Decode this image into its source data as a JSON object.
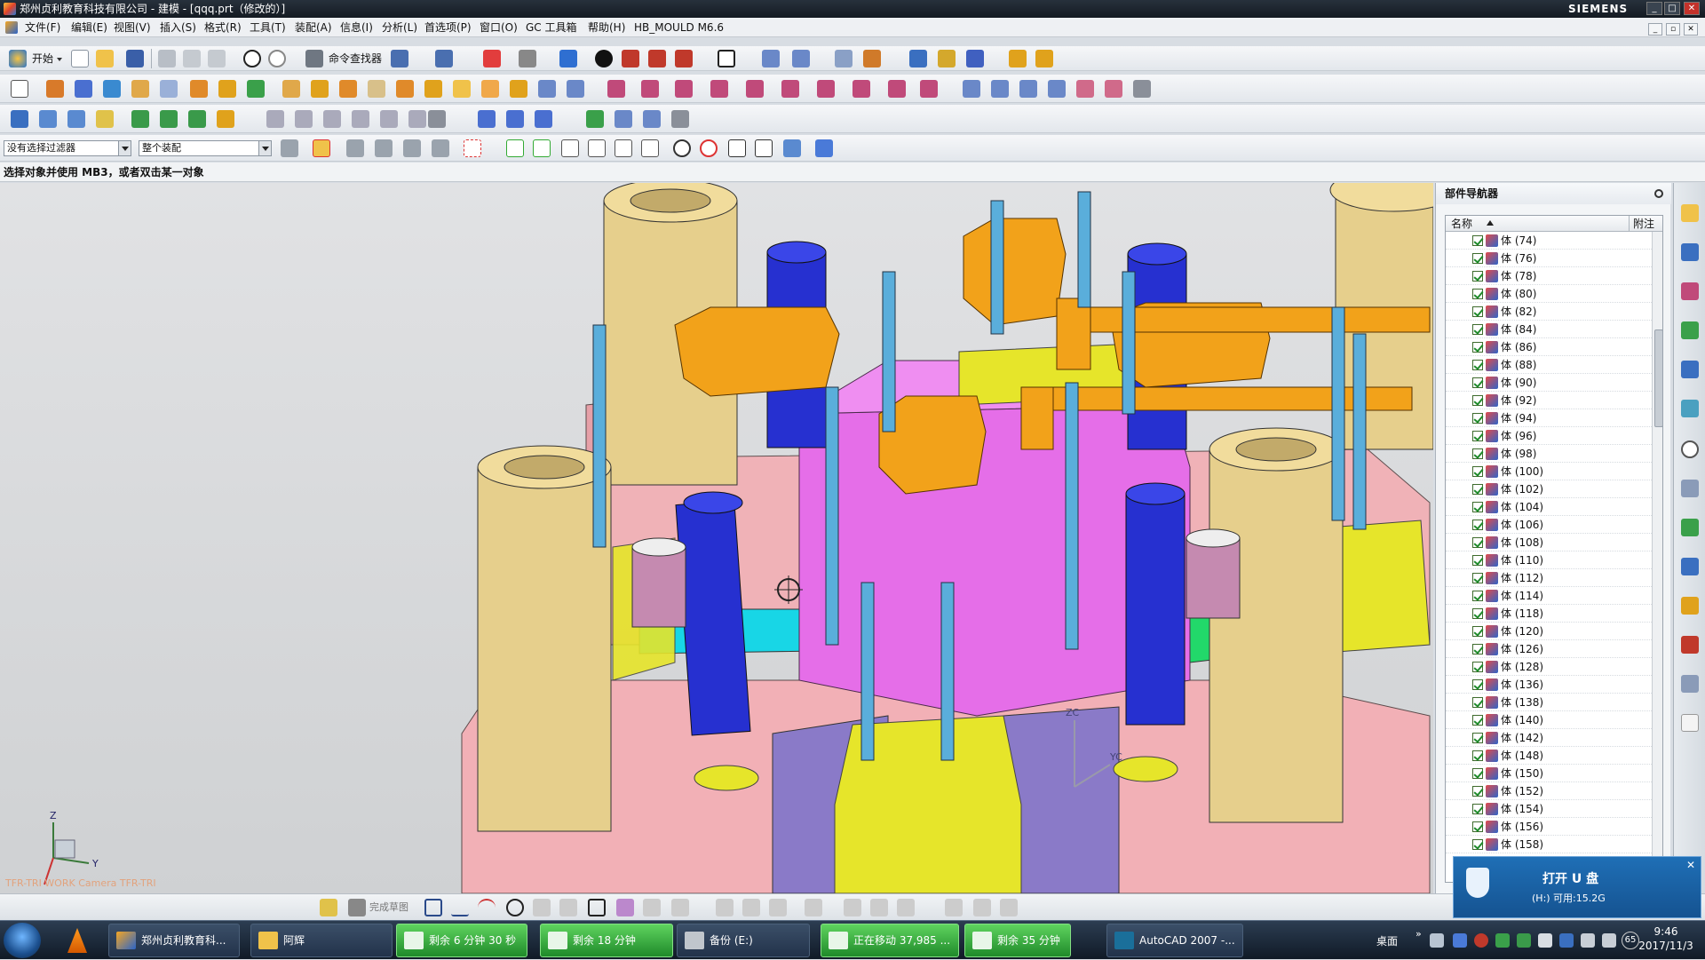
{
  "window": {
    "title": "郑州贞利教育科技有限公司 - 建模 - [qqq.prt（修改的）]",
    "brand": "SIEMENS"
  },
  "menu": [
    "文件(F)",
    "编辑(E)",
    "视图(V)",
    "插入(S)",
    "格式(R)",
    "工具(T)",
    "装配(A)",
    "信息(I)",
    "分析(L)",
    "首选项(P)",
    "窗口(O)",
    "GC 工具箱",
    "帮助(H)",
    "HB_MOULD M6.6"
  ],
  "toolbar": {
    "start_label": "开始",
    "command_finder_label": "命令查找器"
  },
  "filters": {
    "selection_filter": "没有选择过滤器",
    "scope": "整个装配"
  },
  "cue_line": "选择对象并使用 MB3，或者双击某一对象",
  "viewport": {
    "view_label": "TFR-TRI WORK Camera TFR-TRI",
    "triad_labels": {
      "z": "Z",
      "y": "Y",
      "zc": "ZC",
      "yc": "YC"
    }
  },
  "part_navigator": {
    "title": "部件导航器",
    "columns": {
      "name": "名称",
      "note": "附注"
    },
    "items": [
      "体 (74)",
      "体 (76)",
      "体 (78)",
      "体 (80)",
      "体 (82)",
      "体 (84)",
      "体 (86)",
      "体 (88)",
      "体 (90)",
      "体 (92)",
      "体 (94)",
      "体 (96)",
      "体 (98)",
      "体 (100)",
      "体 (102)",
      "体 (104)",
      "体 (106)",
      "体 (108)",
      "体 (110)",
      "体 (112)",
      "体 (114)",
      "体 (118)",
      "体 (120)",
      "体 (126)",
      "体 (128)",
      "体 (136)",
      "体 (138)",
      "体 (140)",
      "体 (142)",
      "体 (148)",
      "体 (150)",
      "体 (152)",
      "体 (154)",
      "体 (156)",
      "体 (158)"
    ]
  },
  "sketch_bar": {
    "finish_sketch": "完成草图"
  },
  "usb_notification": {
    "title": "打开 U 盘",
    "subtitle": "(H:)  可用:15.2G"
  },
  "taskbar": {
    "items": [
      {
        "label": "郑州贞利教育科...",
        "style": "normal"
      },
      {
        "label": "阿辉",
        "style": "normal"
      },
      {
        "label": "剩余 6 分钟 30 秒",
        "style": "green"
      },
      {
        "label": "剩余 18 分钟",
        "style": "green"
      },
      {
        "label": "备份 (E:)",
        "style": "normal"
      },
      {
        "label": "正在移动 37,985 ...",
        "style": "green"
      },
      {
        "label": "剩余 35 分钟",
        "style": "green"
      },
      {
        "label": "AutoCAD 2007 -...",
        "style": "normal"
      }
    ],
    "desktop_label": "桌面",
    "battery_badge": "65",
    "time": "9:46",
    "date": "2017/11/3"
  },
  "colors": {
    "mold_base_pink": "#f2b0b6",
    "core_magenta": "#e56ee8",
    "slider_orange": "#f2a21a",
    "guide_bushing_tan": "#e6cf8c",
    "pin_blue": "#2630d0",
    "screw_cyan": "#5aaedb",
    "block_yellow": "#e6e52a"
  }
}
